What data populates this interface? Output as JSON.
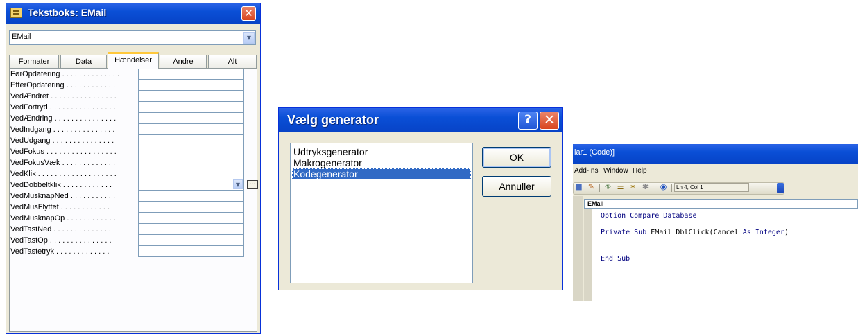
{
  "property_sheet": {
    "title": "Tekstboks: EMail",
    "object_select": "EMail",
    "tabs": [
      "Formater",
      "Data",
      "Hændelser",
      "Andre",
      "Alt"
    ],
    "active_tab": "Hændelser",
    "events": [
      "FørOpdatering . . . . . . . . . . . . . .",
      "EfterOpdatering . . . . . . . . . . . .",
      "VedÆndret . . . . . . . . . . . . . . . .",
      "VedFortryd . . . . . . . . . . . . . . . .",
      "VedÆndring . . . . . . . . . . . . . . .",
      "VedIndgang . . . . . . . . . . . . . . .",
      "VedUdgang . . . . . . . . . . . . . . .",
      "VedFokus . . . . . . . . . . . . . . . . .",
      "VedFokusVæk . . . . . . . . . . . . .",
      "VedKlik . . . . . . . . . . . . . . . . . . .",
      "VedDobbeltklik . . . . . . . . . . . .",
      "VedMusknapNed . . . . . . . . . . .",
      "VedMusFlyttet . . . . . . . . . . . .",
      "VedMusknapOp . . . . . . . . . . . .",
      "VedTastNed . . . . . . . . . . . . . .",
      "VedTastOp . . . . . . . . . . . . . . .",
      "VedTastetryk . . . . . . . . . . . . ."
    ],
    "active_event": "VedDobbeltklik",
    "build_button": "..."
  },
  "builder_dialog": {
    "title": "Vælg generator",
    "help": "?",
    "items": [
      "Udtryksgenerator",
      "Makrogenerator",
      "Kodegenerator"
    ],
    "selected": "Kodegenerator",
    "ok": "OK",
    "cancel": "Annuller"
  },
  "vba_window": {
    "title": "lar1 (Code)]",
    "menu": [
      "Add-Ins",
      "Window",
      "Help"
    ],
    "toolbar_status": "Ln 4, Col 1",
    "object_box": "EMail",
    "code": {
      "line1_kw": "Option Compare Database",
      "line2_kw1": "Private Sub",
      "line2_plain": " EMail_DblClick(Cancel ",
      "line2_kw2": "As Integer",
      "line2_end": ")",
      "line3_kw": "End Sub"
    }
  },
  "colors": {
    "xp_title_blue": "#0a4fd6",
    "selection_blue": "#316ac5",
    "vba_keyword": "#00007f",
    "close_red": "#d9451e"
  }
}
